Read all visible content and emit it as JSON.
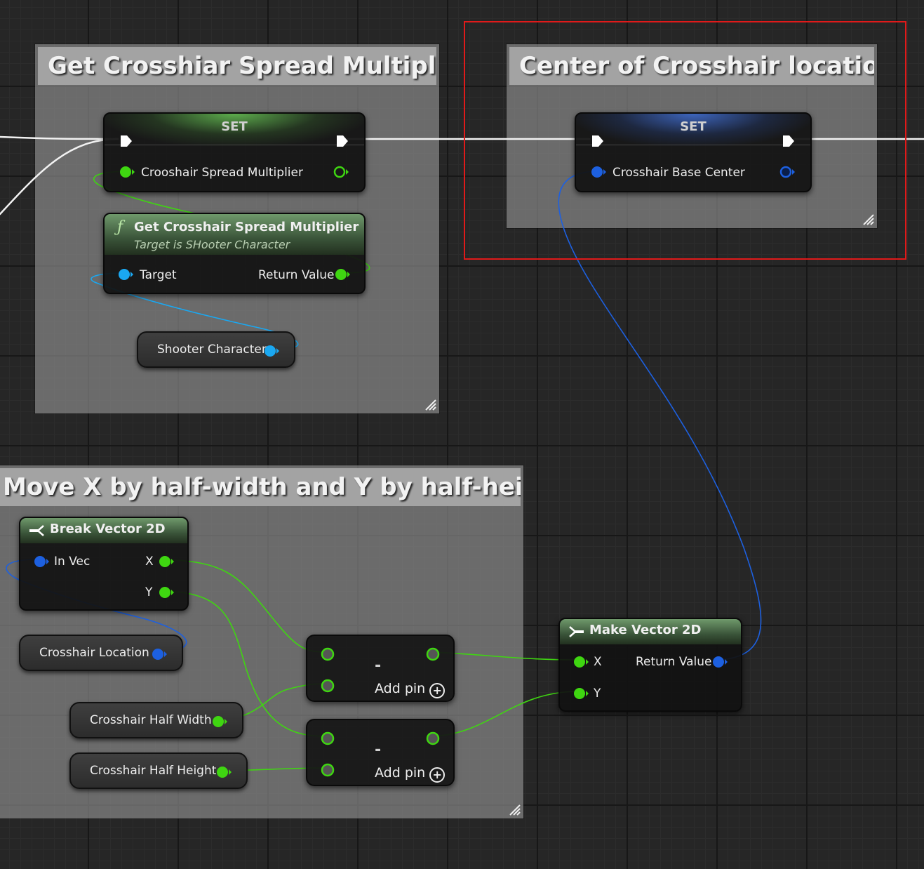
{
  "comments": {
    "spread": {
      "title": "Get Crosshiar Spread Multiplier"
    },
    "center": {
      "title": "Center of Crosshair location"
    },
    "move": {
      "title": "Move X by half-width and Y by half-height"
    }
  },
  "nodes": {
    "set_spread": {
      "title": "SET",
      "pin_label": "Crooshair Spread Multiplier"
    },
    "get_spread_fn": {
      "title": "Get Crosshair Spread Multiplier",
      "subtitle": "Target is SHooter Character",
      "input_label": "Target",
      "output_label": "Return Value"
    },
    "shooter_character": {
      "label": "Shooter Character"
    },
    "set_center": {
      "title": "SET",
      "pin_label": "Crosshair Base Center"
    },
    "break_vector": {
      "title": "Break Vector 2D",
      "input_label": "In Vec",
      "out_x": "X",
      "out_y": "Y"
    },
    "crosshair_location": {
      "label": "Crosshair Location"
    },
    "half_width": {
      "label": "Crosshair Half Width"
    },
    "half_height": {
      "label": "Crosshair Half Height"
    },
    "subtract_1": {
      "symbol": "-",
      "add_pin": "Add pin"
    },
    "subtract_2": {
      "symbol": "-",
      "add_pin": "Add pin"
    },
    "make_vector": {
      "title": "Make Vector 2D",
      "in_x": "X",
      "in_y": "Y",
      "output_label": "Return Value"
    }
  },
  "colors": {
    "exec": "#ffffff",
    "float_pin": "#3fd611",
    "vector2d_pin": "#1d60e0",
    "object_pin": "#1aa8f2",
    "selection": "#e01a1a"
  },
  "icons": {
    "function": "function-icon",
    "break": "break-struct-icon",
    "make": "make-struct-icon",
    "exec": "exec-pin-icon",
    "add": "add-pin-plus-icon",
    "resize": "resize-grip-icon"
  }
}
